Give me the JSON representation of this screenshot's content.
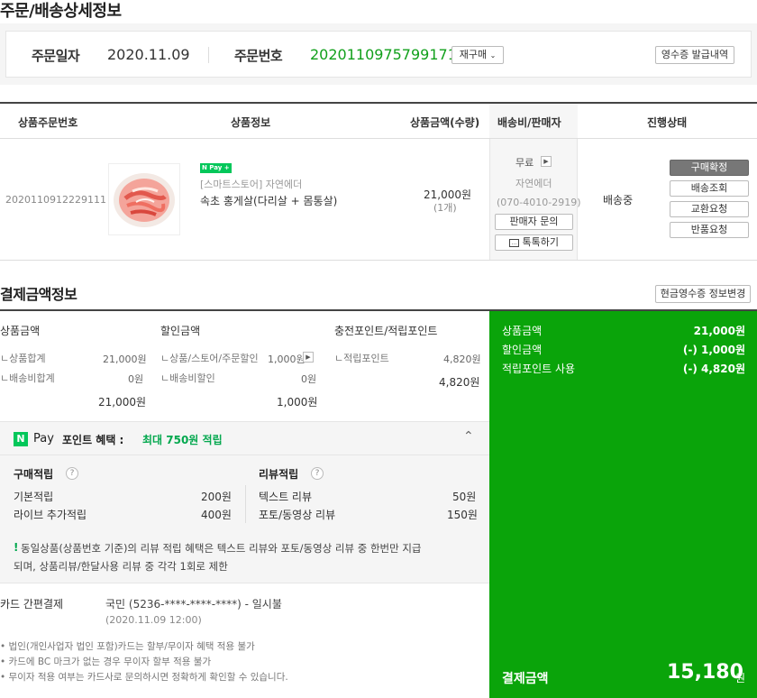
{
  "page_title": "주문/배송상세정보",
  "order": {
    "date_label": "주문일자",
    "date_value": "2020.11.09",
    "number_label": "주문번호",
    "number_value": "2020110975799171",
    "reorder_label": "재구매",
    "receipt_button": "영수증 발급내역"
  },
  "table": {
    "headers": [
      "상품주문번호",
      "상품정보",
      "상품금액(수량)",
      "배송비/판매자",
      "진행상태"
    ],
    "row": {
      "product_order_no": "2020110912229111",
      "npay_badge": "N Pay +",
      "store": "[스마트스토어] 자연에더",
      "product_name": "속초 홍게살(다리살 + 몸통살)",
      "price": "21,000원",
      "qty": "(1개)",
      "shipping_fee": "무료",
      "seller": "자연에더",
      "phone": "(070-4010-2919)",
      "seller_inquiry": "판매자 문의",
      "talktalk": "톡톡하기",
      "status": "배송중",
      "actions": [
        "구매확정",
        "배송조회",
        "교환요청",
        "반품요청"
      ]
    }
  },
  "payment": {
    "title": "결제금액정보",
    "cash_receipt_button": "현금영수증 정보변경",
    "product_amount": {
      "label": "상품금액",
      "items": [
        {
          "name": "상품합계",
          "value": "21,000원"
        },
        {
          "name": "배송비합계",
          "value": "0원"
        }
      ],
      "total": "21,000원"
    },
    "discount": {
      "label": "할인금액",
      "items": [
        {
          "name": "상품/스토어/주문할인",
          "value": "1,000원"
        },
        {
          "name": "배송비할인",
          "value": "0원"
        }
      ],
      "total": "1,000원"
    },
    "points": {
      "label": "충전포인트/적립포인트",
      "items": [
        {
          "name": "적립포인트",
          "value": "4,820원"
        }
      ],
      "total": "4,820원"
    },
    "summary": [
      {
        "label": "상품금액",
        "value": "21,000원"
      },
      {
        "label": "할인금액",
        "value": "(-) 1,000원"
      },
      {
        "label": "적립포인트 사용",
        "value": "(-) 4,820원"
      }
    ],
    "final_label": "결제금액",
    "final_value": "15,180",
    "final_unit": "원"
  },
  "npay_benefit": {
    "logo": "N",
    "pay": "Pay",
    "title": "포인트 혜택 :",
    "highlight": "최대 750원 적립",
    "purchase_title": "구매적립",
    "purchase_items": [
      {
        "name": "기본적립",
        "value": "200원"
      },
      {
        "name": "라이브 추가적립",
        "value": "400원"
      }
    ],
    "review_title": "리뷰적립",
    "review_items": [
      {
        "name": "텍스트 리뷰",
        "value": "50원"
      },
      {
        "name": "포토/동영상 리뷰",
        "value": "150원"
      }
    ],
    "notice_mark": "!",
    "notice_line1": "동일상품(상품번호 기준)의 리뷰 적립 혜택은 텍스트 리뷰와 포토/동영상 리뷰 중 한번만 지급",
    "notice_line2": "되며, 상품리뷰/한달사용 리뷰 중 각각 1회로 제한"
  },
  "card": {
    "label": "카드 간편결제",
    "value": "국민 (5236-****-****-****) - 일시불",
    "datetime": "(2020.11.09 12:00)",
    "notes": [
      "법인(개인사업자 법인 포함)카드는 할부/무이자 혜택 적용 불가",
      "카드에 BC 마크가 없는 경우 무이자 할부 적용 불가",
      "무이자 적용 여부는 카드사로 문의하시면 정확하게 확인할 수 있습니다."
    ]
  },
  "colors": {
    "green": "#0aa40a",
    "accent_green": "#11a01b",
    "npay_green": "#03c75a"
  }
}
